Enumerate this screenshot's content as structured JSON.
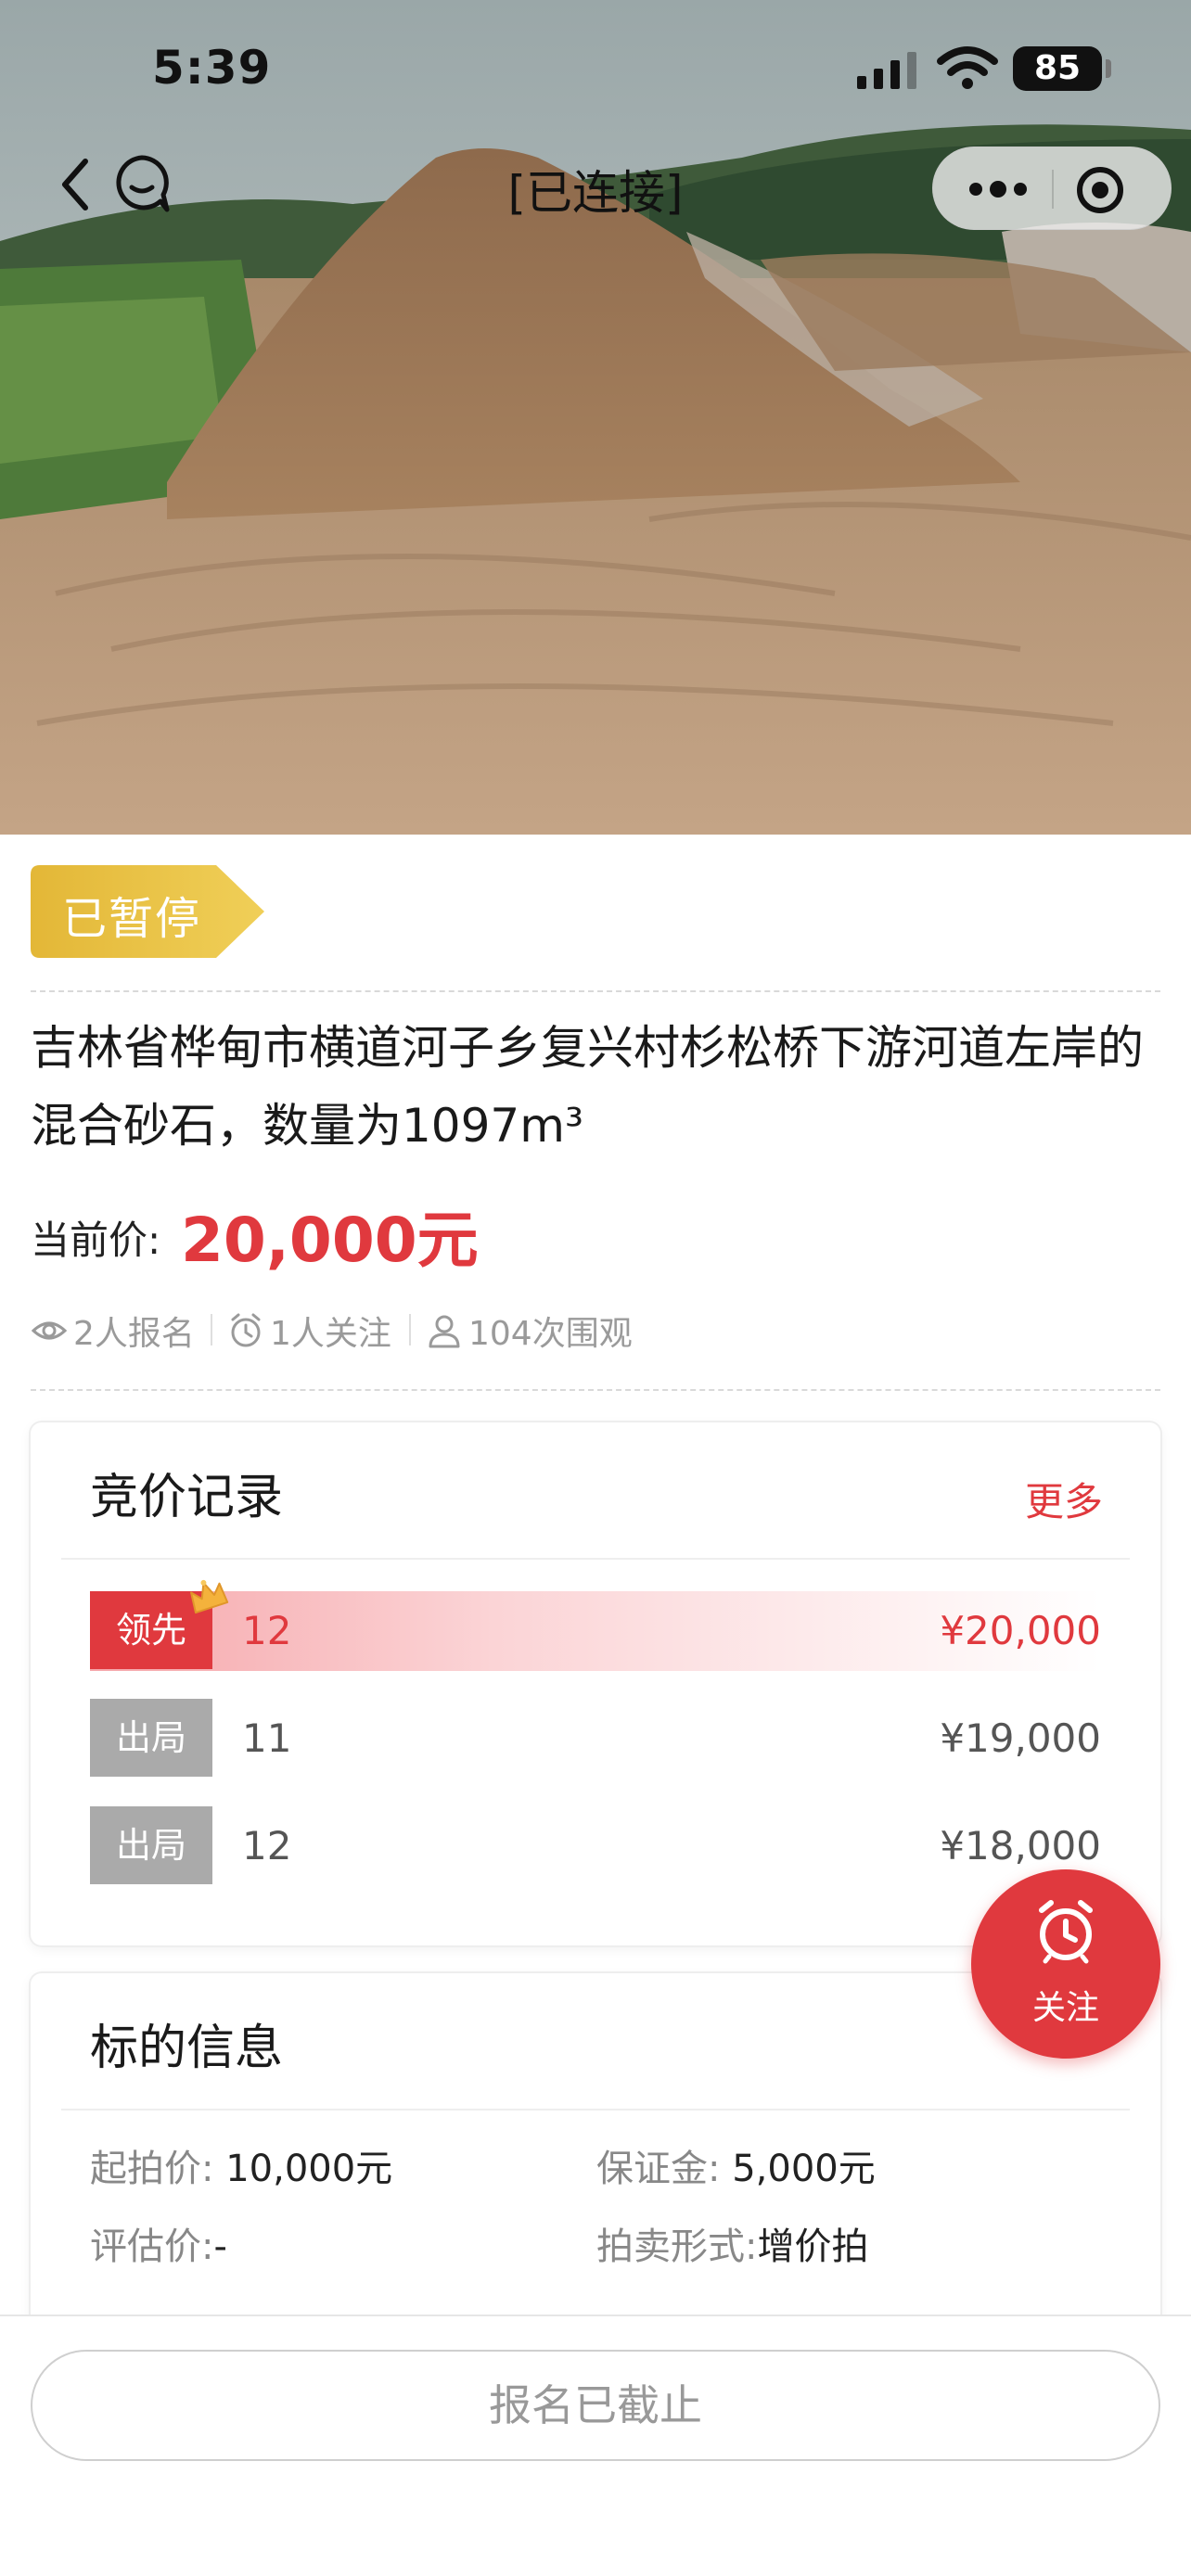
{
  "status_bar": {
    "time": "5:39",
    "battery": "85"
  },
  "nav": {
    "title": "[已连接]"
  },
  "lot": {
    "status_tag": "已暂停",
    "title": "吉林省桦甸市横道河子乡复兴村杉松桥下游河道左岸的混合砂石，数量为1097m³",
    "price_label": "当前价:",
    "price_value": "20,000元",
    "stats": {
      "signups": "2人报名",
      "follows": "1人关注",
      "views": "104次围观"
    }
  },
  "bids": {
    "title": "竞价记录",
    "more": "更多",
    "records": [
      {
        "status": "领先",
        "user": "12",
        "amount": "¥20,000"
      },
      {
        "status": "出局",
        "user": "11",
        "amount": "¥19,000"
      },
      {
        "status": "出局",
        "user": "12",
        "amount": "¥18,000"
      }
    ]
  },
  "subject_info": {
    "title": "标的信息",
    "start_price_label": "起拍价:",
    "start_price": "10,000元",
    "deposit_label": "保证金:",
    "deposit": "5,000元",
    "appraisal_label": "评估价:",
    "appraisal": "-",
    "auction_type_label": "拍卖形式:",
    "auction_type": "增价拍"
  },
  "follow_button": {
    "label": "关注"
  },
  "signup_button": {
    "label": "报名已截止"
  },
  "colors": {
    "accent": "#e0393e",
    "tag_gold": "#e9c03f",
    "muted_gray": "#aaaaaa"
  }
}
